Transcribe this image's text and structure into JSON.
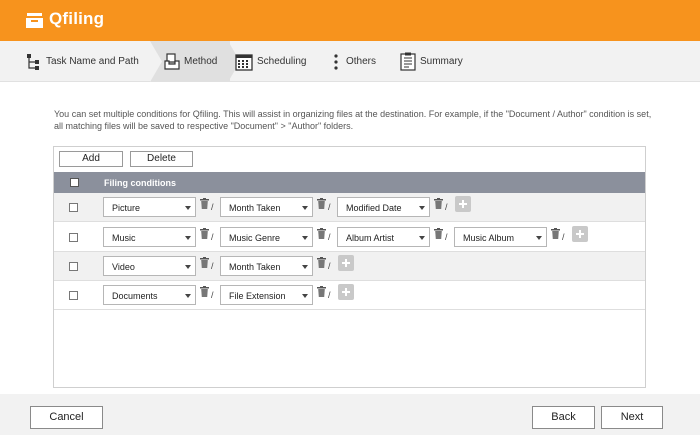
{
  "app": {
    "title": "Qfiling",
    "accent": "#f7931d"
  },
  "steps": [
    {
      "label": "Task Name and Path",
      "icon": "tree-icon"
    },
    {
      "label": "Method",
      "icon": "inbox-tray-icon"
    },
    {
      "label": "Scheduling",
      "icon": "calendar-icon"
    },
    {
      "label": "Others",
      "icon": "more-vertical-icon"
    },
    {
      "label": "Summary",
      "icon": "clipboard-icon"
    }
  ],
  "active_step": "Method",
  "description": "You can set multiple conditions for Qfiling. This will assist in organizing files at the destination. For example, if the \"Document / Author\" condition is set, all matching files will be saved to respective \"Document\" > \"Author\" folders.",
  "toolbar": {
    "add_label": "Add",
    "delete_label": "Delete"
  },
  "table": {
    "header": "Filing conditions"
  },
  "rows": [
    {
      "conditions": [
        "Picture",
        "Month Taken",
        "Modified Date"
      ]
    },
    {
      "conditions": [
        "Music",
        "Music Genre",
        "Album Artist",
        "Music Album"
      ]
    },
    {
      "conditions": [
        "Video",
        "Month Taken"
      ]
    },
    {
      "conditions": [
        "Documents",
        "File Extension"
      ]
    }
  ],
  "footer": {
    "cancel_label": "Cancel",
    "back_label": "Back",
    "next_label": "Next"
  }
}
